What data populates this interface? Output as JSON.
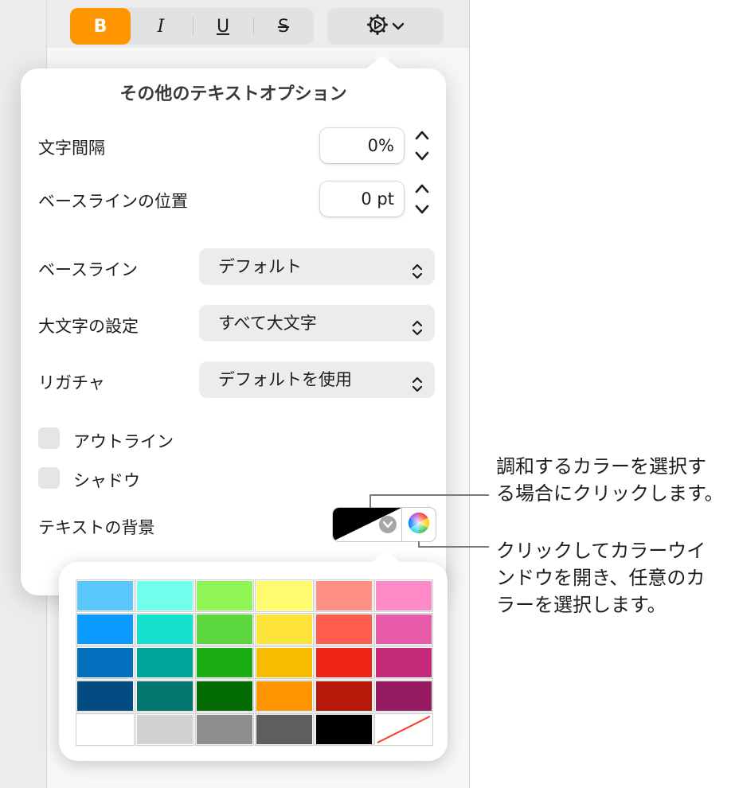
{
  "toolbar": {
    "bold_label": "B",
    "italic_label": "I",
    "underline_label": "U",
    "strike_label": "S",
    "gear_icon": "gear-icon",
    "chevron_icon": "chevron-down-icon"
  },
  "popover": {
    "title": "その他のテキストオプション",
    "character_spacing": {
      "label": "文字間隔",
      "value": "0%"
    },
    "baseline_shift": {
      "label": "ベースラインの位置",
      "value": "0 pt"
    },
    "baseline": {
      "label": "ベースライン",
      "value": "デフォルト"
    },
    "capitalization": {
      "label": "大文字の設定",
      "value": "すべて大文字"
    },
    "ligatures": {
      "label": "リガチャ",
      "value": "デフォルトを使用"
    },
    "outline": {
      "label": "アウトライン",
      "checked": false
    },
    "shadow": {
      "label": "シャドウ",
      "checked": false
    },
    "text_background": {
      "label": "テキストの背景",
      "color": "#000000"
    }
  },
  "swatches": {
    "rows": [
      [
        "#5ac8fa",
        "#6fffea",
        "#8ef554",
        "#fffb6e",
        "#ff8f84",
        "#ff8ac8"
      ],
      [
        "#0a9bff",
        "#14e0cc",
        "#5bd63d",
        "#fde33a",
        "#ff5d4d",
        "#e85ba8"
      ],
      [
        "#0270bd",
        "#00a59a",
        "#1aae12",
        "#f9bb00",
        "#ef2414",
        "#c42a78"
      ],
      [
        "#024c82",
        "#00766f",
        "#026b02",
        "#ff9500",
        "#b81807",
        "#961a62"
      ],
      [
        "#ffffff",
        "#d1d1d1",
        "#8e8e8e",
        "#5e5e5e",
        "#000000",
        "none"
      ]
    ]
  },
  "callouts": {
    "harmony": [
      "調和するカラーを選択す",
      "る場合にクリックします。"
    ],
    "wheel": [
      "クリックしてカラーウイ",
      "ンドウを開き、任意のカ",
      "ラーを選択します。"
    ]
  }
}
